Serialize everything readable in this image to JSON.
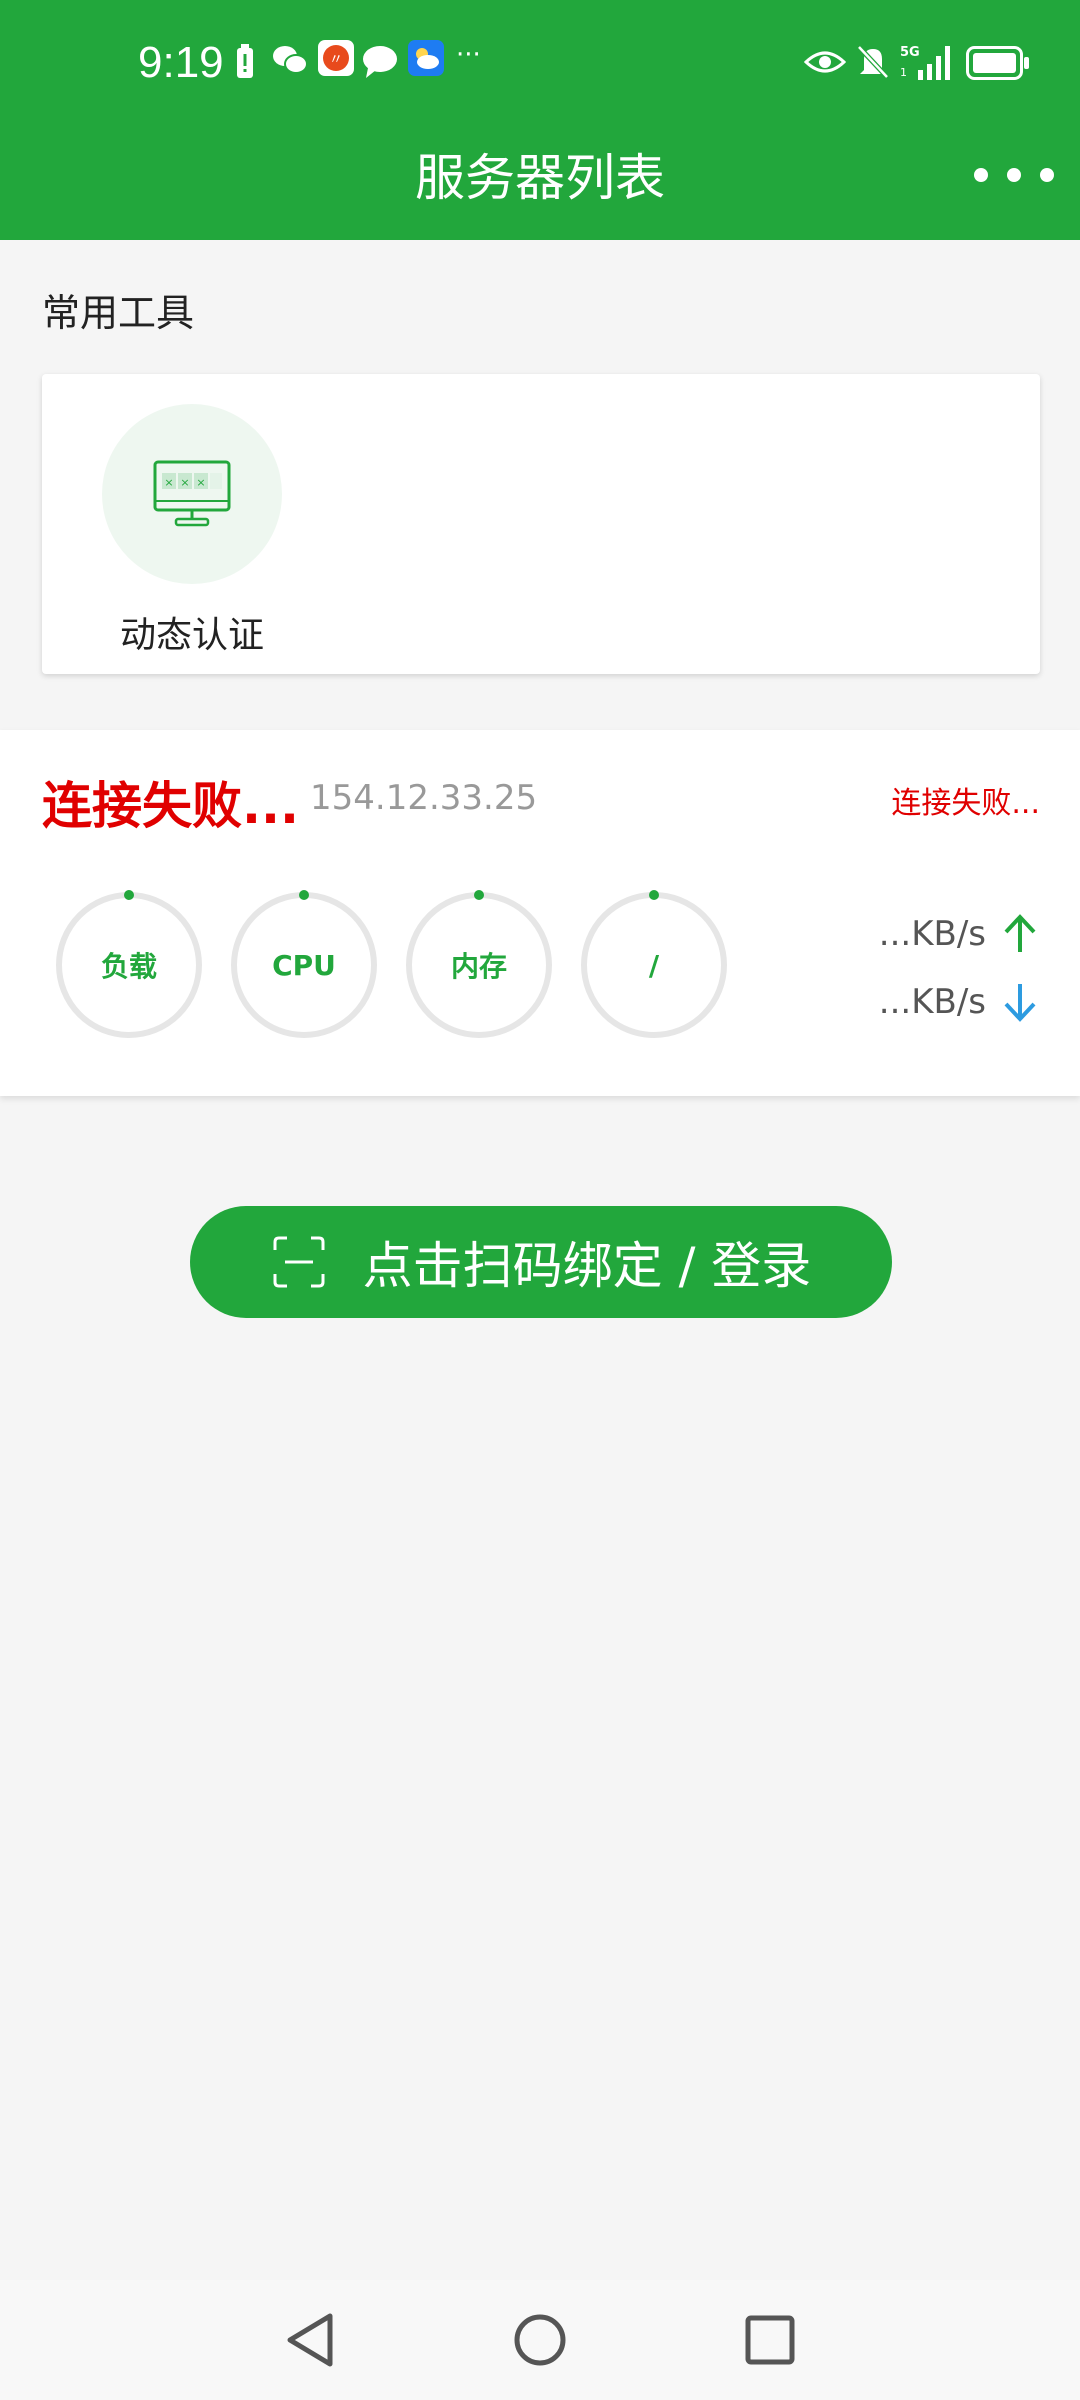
{
  "status_bar": {
    "time": "9:19",
    "notification_icons": [
      "battery-alert-icon",
      "wechat-icon",
      "app-icon",
      "message-icon",
      "weather-icon"
    ],
    "overflow": "···",
    "system_icons": [
      "eye-icon",
      "bell-muted-icon",
      "signal-5g-icon",
      "battery-icon"
    ]
  },
  "header": {
    "title": "服务器列表"
  },
  "tools": {
    "section_title": "常用工具",
    "items": [
      {
        "label": "动态认证",
        "icon": "monitor-icon"
      }
    ]
  },
  "server": {
    "name": "连接失败...",
    "ip": "154.12.33.25",
    "status": "连接失败...",
    "gauges": [
      {
        "label": "负载"
      },
      {
        "label": "CPU"
      },
      {
        "label": "内存"
      },
      {
        "label": "/"
      }
    ],
    "upload_speed": "...KB/s",
    "download_speed": "...KB/s"
  },
  "scan_button": {
    "label": "点击扫码绑定 / 登录"
  },
  "colors": {
    "brand": "#22a73c",
    "error": "#e00000",
    "download_arrow": "#2d9be0",
    "upload_arrow": "#22a73c"
  }
}
